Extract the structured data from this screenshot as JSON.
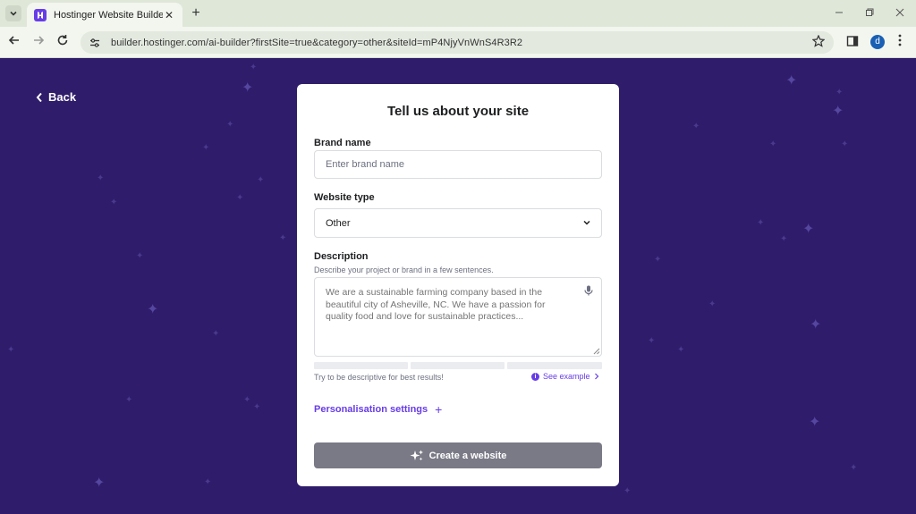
{
  "browser": {
    "tab_title": "Hostinger Website Builder",
    "tab_close": "✕",
    "new_tab": "+",
    "url": "builder.hostinger.com/ai-builder?firstSite=true&category=other&siteId=mP4NjyVnWnS4R3R2",
    "avatar_letter": "d",
    "icons": {
      "tab_menu": "chevron-down-icon",
      "back": "arrow-left-icon",
      "forward": "arrow-right-icon",
      "reload": "reload-icon",
      "site_settings": "tune-icon",
      "bookmark": "star-icon",
      "side_panel": "side-panel-icon",
      "menu": "kebab-icon",
      "minimize": "minimize-icon",
      "restore": "restore-icon",
      "close": "close-icon"
    }
  },
  "page": {
    "back_label": "Back",
    "colors": {
      "background": "#2f1c6a",
      "accent": "#673de6",
      "button_disabled": "#7a7a86"
    }
  },
  "form": {
    "title": "Tell us about your site",
    "brand_name": {
      "label": "Brand name",
      "placeholder": "Enter brand name",
      "value": ""
    },
    "website_type": {
      "label": "Website type",
      "value": "Other"
    },
    "description": {
      "label": "Description",
      "helper": "Describe your project or brand in a few sentences.",
      "placeholder": "We are a sustainable farming company based in the beautiful city of Asheville, NC. We have a passion for quality food and love for sustainable practices..."
    },
    "hint": "Try to be descriptive for best results!",
    "see_example": "See example",
    "personalisation": "Personalisation settings",
    "submit": "Create a website"
  }
}
